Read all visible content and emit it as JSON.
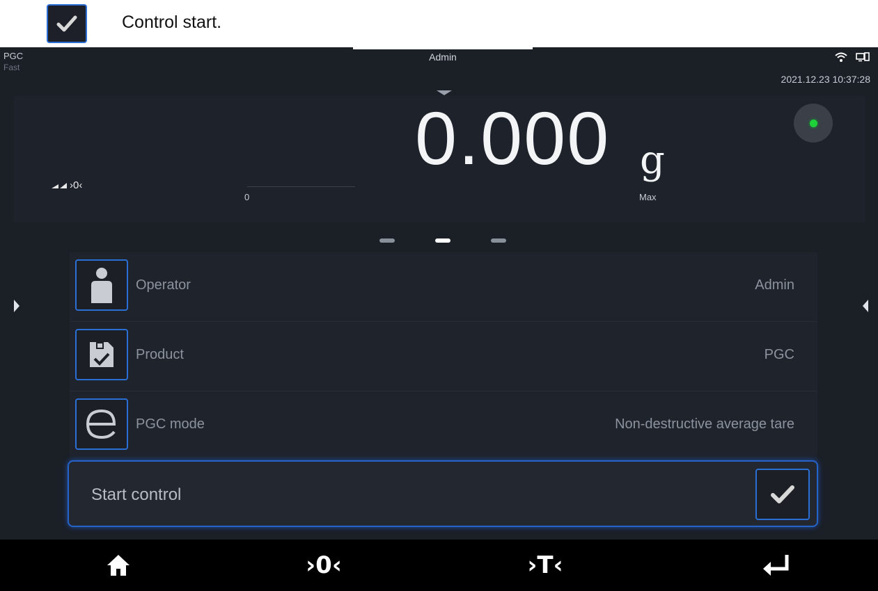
{
  "caption": {
    "text": "Control start.",
    "icon": "checkmark-icon"
  },
  "status_bar": {
    "product": "PGC",
    "mode": "Fast",
    "user": "Admin",
    "datetime": "2021.12.23 10:37:28",
    "icons": [
      "wifi-icon",
      "computer-connection-icon"
    ]
  },
  "weight": {
    "value": "0.000",
    "unit": "g",
    "bar_min": "0",
    "bar_max": "Max",
    "zero_indicator": "›0‹",
    "stability_color": "#1fd23a"
  },
  "pager": {
    "count": 3,
    "active": 1
  },
  "list": {
    "items": [
      {
        "label": "Operator",
        "value": "Admin",
        "icon": "operator-icon"
      },
      {
        "label": "Product",
        "value": "PGC",
        "icon": "product-icon"
      },
      {
        "label": "PGC mode",
        "value": "Non-destructive average tare",
        "icon": "pgc-mode-icon"
      }
    ]
  },
  "start_control": {
    "label": "Start control",
    "icon": "checkmark-icon"
  },
  "bottom_bar": {
    "home_icon": "home-icon",
    "zero_label": "›0‹",
    "tare_label": "›T‹",
    "enter_icon": "enter-icon"
  },
  "colors": {
    "accent": "#2a6fd6",
    "background": "#1b1f26",
    "bottom_bar": "#000000"
  }
}
